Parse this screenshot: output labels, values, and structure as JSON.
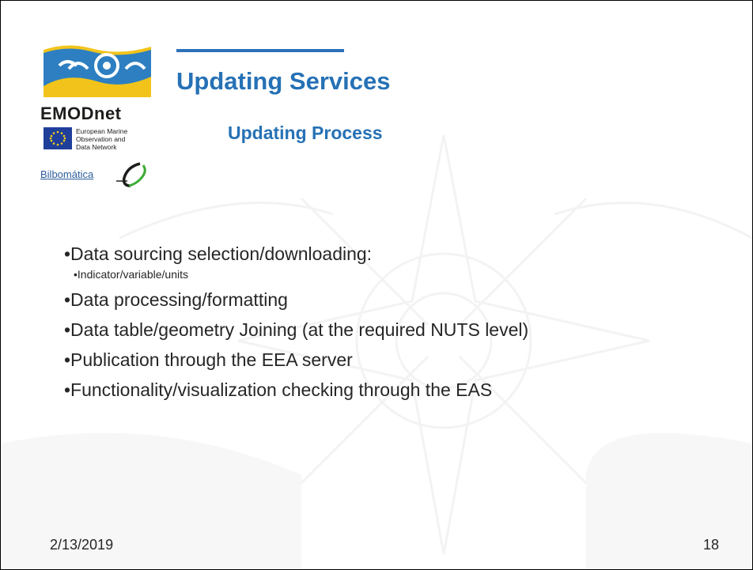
{
  "logo": {
    "brand": "EMODnet",
    "eu_lines": [
      "European Marine",
      "Observation and",
      "Data Network"
    ],
    "partner": "Bilbomática"
  },
  "title": "Updating Services",
  "subtitle": "Updating Process",
  "bullets": [
    {
      "text": "•Data sourcing selection/downloading:",
      "level": 1
    },
    {
      "text": "•Indicator/variable/units",
      "level": 2
    },
    {
      "text": "•Data processing/formatting",
      "level": 1
    },
    {
      "text": "•Data table/geometry Joining (at the required NUTS level)",
      "level": 1
    },
    {
      "text": "•Publication through the EEA server",
      "level": 1
    },
    {
      "text": "•Functionality/visualization checking through the EAS",
      "level": 1
    }
  ],
  "footer": {
    "date": "2/13/2019",
    "page": "18"
  },
  "colors": {
    "title": "#2671b5",
    "accent_rule": "#2d71b8",
    "logo_blue": "#2d7fc1",
    "logo_yellow": "#f2c41b"
  }
}
